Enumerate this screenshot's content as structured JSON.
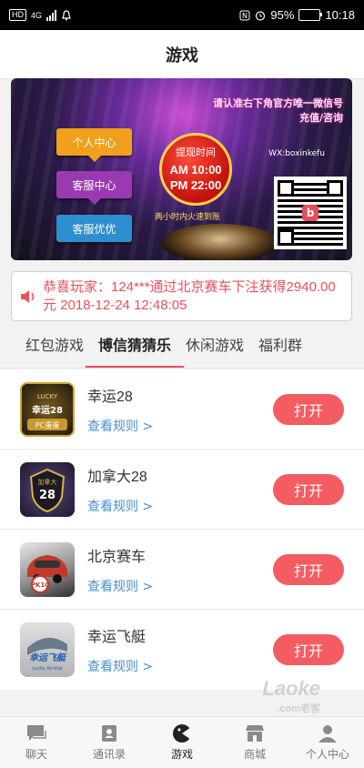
{
  "status_bar": {
    "network": "HD",
    "signal": "4G",
    "battery_pct": "95%",
    "time": "10:18"
  },
  "header": {
    "title": "游戏"
  },
  "banner": {
    "notice_line1": "请认准右下角官方唯一微信号",
    "notice_line2": "充值/咨询",
    "wechat": "WX:boxinkefu",
    "buttons": [
      "个人中心",
      "客服中心",
      "客服优优"
    ],
    "clock_title": "提现时间",
    "clock_am": "AM 10:00",
    "clock_pm": "PM 22:00",
    "note": "两小时内火速到账",
    "qr_logo": "b"
  },
  "notice": {
    "text": "恭喜玩家：124***通过北京赛车下注获得2940.00元 2018-12-24 12:48:05"
  },
  "tabs": [
    {
      "label": "红包游戏"
    },
    {
      "label": "博信猜猜乐"
    },
    {
      "label": "休闲游戏"
    },
    {
      "label": "福利群"
    }
  ],
  "games": [
    {
      "name": "幸运28",
      "rule": "查看规则 >",
      "button": "打开",
      "icon_text": "幸运28",
      "icon_sub": "PC蛋蛋",
      "icon_top": "LUCKY"
    },
    {
      "name": "加拿大28",
      "rule": "查看规则 >",
      "button": "打开",
      "icon_text": "28",
      "icon_top": "加拿大"
    },
    {
      "name": "北京赛车",
      "rule": "查看规则 >",
      "button": "打开",
      "icon_text": "PK10"
    },
    {
      "name": "幸运飞艇",
      "rule": "查看规则 >",
      "button": "打开",
      "icon_text": "幸运飞艇",
      "icon_sub": "Lucky Airship"
    }
  ],
  "watermark": {
    "main": "Laoke",
    "sub": ".com老客"
  },
  "bottom_nav": [
    {
      "label": "聊天",
      "icon": "chat-icon"
    },
    {
      "label": "通讯录",
      "icon": "contacts-icon"
    },
    {
      "label": "游戏",
      "icon": "game-icon"
    },
    {
      "label": "商城",
      "icon": "shop-icon"
    },
    {
      "label": "个人中心",
      "icon": "profile-icon"
    }
  ],
  "colors": {
    "accent": "#f35d62",
    "notice_text": "#e8505b",
    "link": "#4a8fd6"
  }
}
